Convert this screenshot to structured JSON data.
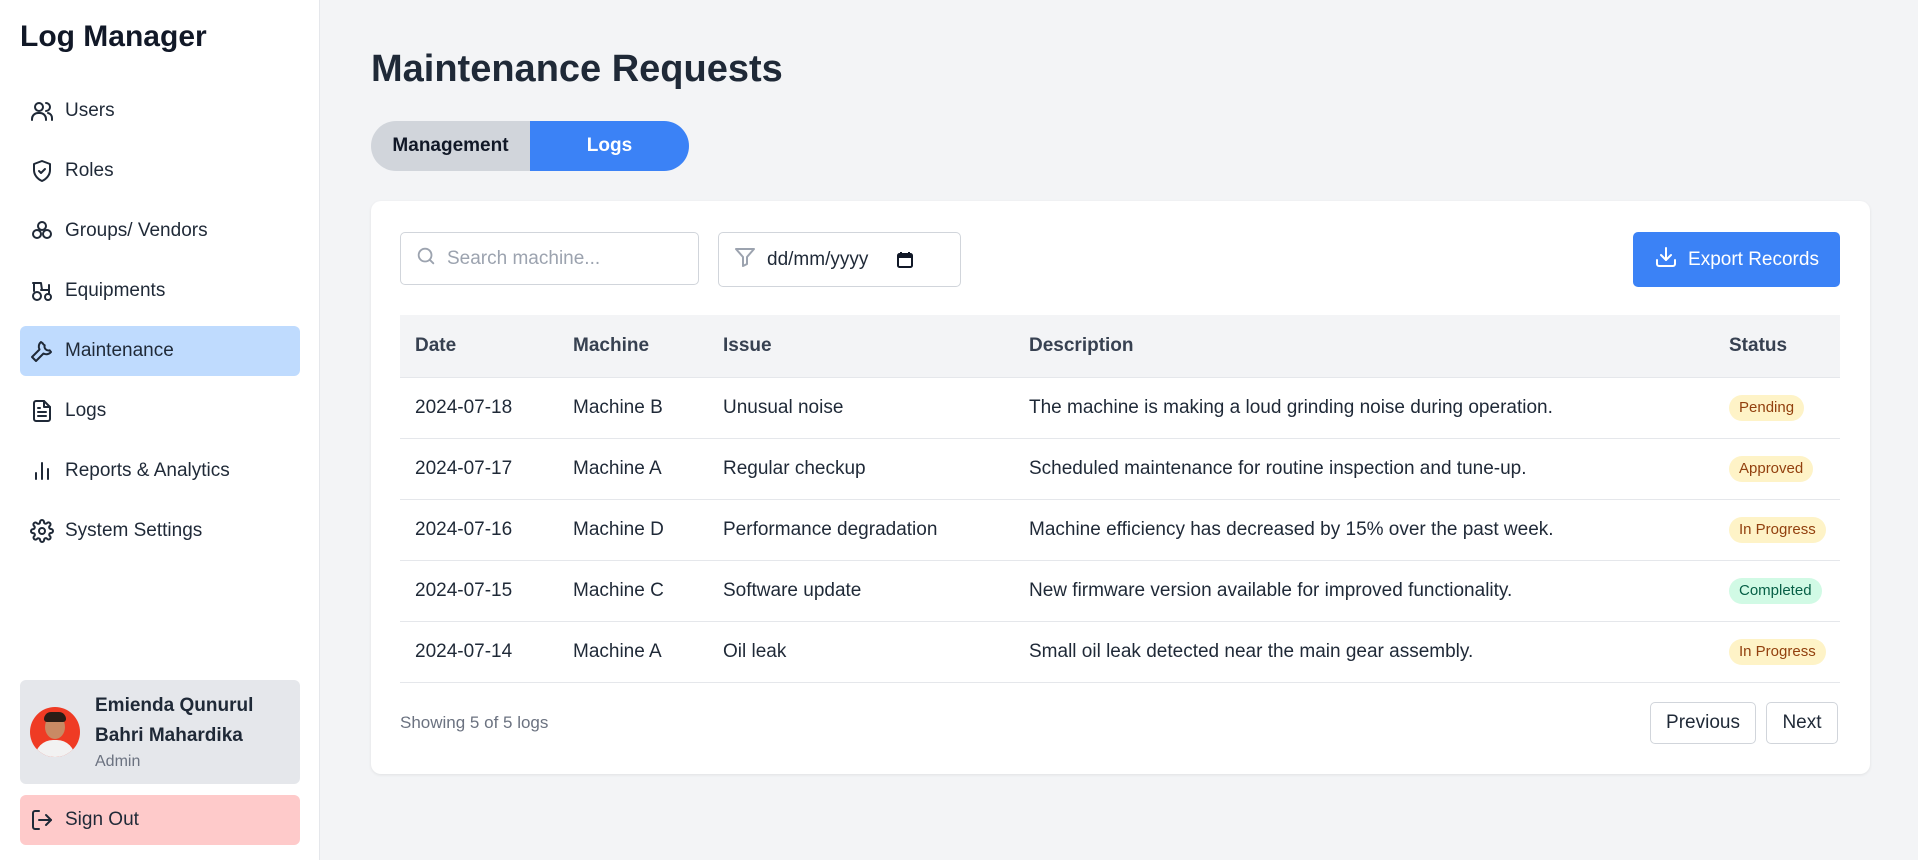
{
  "app": {
    "title": "Log Manager"
  },
  "sidebar": {
    "items": [
      {
        "label": "Users",
        "icon": "users-icon",
        "active": false
      },
      {
        "label": "Roles",
        "icon": "shield-check-icon",
        "active": false
      },
      {
        "label": "Groups/ Vendors",
        "icon": "groups-icon",
        "active": false
      },
      {
        "label": "Equipments",
        "icon": "tractor-icon",
        "active": false
      },
      {
        "label": "Maintenance",
        "icon": "wrench-icon",
        "active": true
      },
      {
        "label": "Logs",
        "icon": "document-icon",
        "active": false
      },
      {
        "label": "Reports & Analytics",
        "icon": "bar-chart-icon",
        "active": false
      },
      {
        "label": "System Settings",
        "icon": "gear-icon",
        "active": false
      }
    ],
    "user": {
      "name": "Emienda Qunurul Bahri Mahardika",
      "role": "Admin"
    },
    "signout_label": "Sign Out"
  },
  "main": {
    "title": "Maintenance Requests",
    "tabs": [
      {
        "label": "Management",
        "active": false
      },
      {
        "label": "Logs",
        "active": true
      }
    ],
    "search": {
      "placeholder": "Search machine...",
      "value": ""
    },
    "date_filter": {
      "value": "dd/mm/yyyy"
    },
    "export_label": "Export Records",
    "table": {
      "columns": [
        "Date",
        "Machine",
        "Issue",
        "Description",
        "Status"
      ],
      "rows": [
        {
          "date": "2024-07-18",
          "machine": "Machine B",
          "issue": "Unusual noise",
          "description": "The machine is making a loud grinding noise during operation.",
          "status": "Pending"
        },
        {
          "date": "2024-07-17",
          "machine": "Machine A",
          "issue": "Regular checkup",
          "description": "Scheduled maintenance for routine inspection and tune-up.",
          "status": "Approved"
        },
        {
          "date": "2024-07-16",
          "machine": "Machine D",
          "issue": "Performance degradation",
          "description": "Machine efficiency has decreased by 15% over the past week.",
          "status": "In Progress"
        },
        {
          "date": "2024-07-15",
          "machine": "Machine C",
          "issue": "Software update",
          "description": "New firmware version available for improved functionality.",
          "status": "Completed"
        },
        {
          "date": "2024-07-14",
          "machine": "Machine A",
          "issue": "Oil leak",
          "description": "Small oil leak detected near the main gear assembly.",
          "status": "In Progress"
        }
      ]
    },
    "footer": {
      "showing": "Showing 5 of 5 logs",
      "previous_label": "Previous",
      "next_label": "Next"
    }
  },
  "colors": {
    "accent": "#3b82f6",
    "active_nav": "#bfdbfe",
    "signout_bg": "#fecaca",
    "badge_yellow": "#fef3c7",
    "badge_green": "#d1fae5"
  }
}
